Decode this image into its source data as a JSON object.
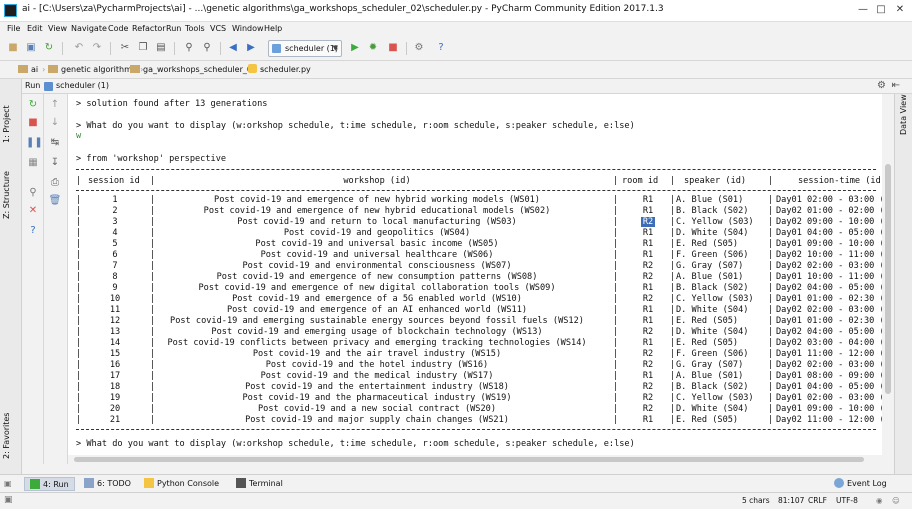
{
  "window": {
    "title": "ai - [C:\\Users\\za\\PycharmProjects\\ai] - ...\\genetic algorithms\\ga_workshops_scheduler_02\\scheduler.py - PyCharm Community Edition 2017.1.3"
  },
  "menu": [
    "File",
    "Edit",
    "View",
    "Navigate",
    "Code",
    "Refactor",
    "Run",
    "Tools",
    "VCS",
    "Window",
    "Help"
  ],
  "toolbar": {
    "run_config": "scheduler (1)"
  },
  "breadcrumbs": [
    "ai",
    "genetic algorithms",
    "ga_workshops_scheduler_02",
    "scheduler.py"
  ],
  "run_panel": {
    "label": "Run",
    "config_name": "scheduler (1)"
  },
  "side_tabs": {
    "project": "1: Project",
    "structure": "Z: Structure",
    "favorites": "2: Favorites",
    "data_view": "Data View"
  },
  "console": {
    "line1": "> solution found after 13 generations",
    "line2": "> What do you want to display (w:orkshop schedule, t:ime schedule, r:oom schedule, s:peaker schedule, e:lse)",
    "input": "w",
    "line3": "> from 'workshop' perspective",
    "header": {
      "session_id": "session id",
      "workshop": "workshop (id)",
      "room_id": "room id",
      "speaker": "speaker (id)",
      "session_time": "session-time (id)"
    },
    "rows": [
      {
        "id": "1",
        "workshop": "Post covid-19 and emergence of new hybrid working models (WS01)",
        "room": "R1",
        "speaker": "A. Blue (S01)",
        "time": "Day01 02:00 - 03:00 (d"
      },
      {
        "id": "2",
        "workshop": "Post covid-19 and emergence of new hybrid educational models (WS02)",
        "room": "R1",
        "speaker": "B. Black (S02)",
        "time": "Day02 01:00 - 02:00 (d"
      },
      {
        "id": "3",
        "workshop": "Post covid-19 and return to local manufacturing (WS03)",
        "room": "R2",
        "speaker": "C. Yellow (S03)",
        "time": "Day02 09:00 - 10:00 (d"
      },
      {
        "id": "4",
        "workshop": "Post covid-19 and geopolitics (WS04)",
        "room": "R1",
        "speaker": "D. White (S04)",
        "time": "Day01 04:00 - 05:00 (d"
      },
      {
        "id": "5",
        "workshop": "Post covid-19 and universal basic income (WS05)",
        "room": "R1",
        "speaker": "E. Red (S05)",
        "time": "Day01 09:00 - 10:00 (d"
      },
      {
        "id": "6",
        "workshop": "Post covid-19 and universal healthcare (WS06)",
        "room": "R1",
        "speaker": "F. Green (S06)",
        "time": "Day02 10:00 - 11:00 (d"
      },
      {
        "id": "7",
        "workshop": "Post covid-19 and environmental consciousness (WS07)",
        "room": "R2",
        "speaker": "G. Gray (S07)",
        "time": "Day02 02:00 - 03:00 (d"
      },
      {
        "id": "8",
        "workshop": "Post covid-19 and emergence of new consumption patterns (WS08)",
        "room": "R2",
        "speaker": "A. Blue (S01)",
        "time": "Day01 10:00 - 11:00 (d"
      },
      {
        "id": "9",
        "workshop": "Post covid-19 and emergence of new digital collaboration tools (WS09)",
        "room": "R1",
        "speaker": "B. Black (S02)",
        "time": "Day02 04:00 - 05:00 (d"
      },
      {
        "id": "10",
        "workshop": "Post covid-19 and emergence of a 5G enabled world (WS10)",
        "room": "R2",
        "speaker": "C. Yellow (S03)",
        "time": "Day01 01:00 - 02:30 (d"
      },
      {
        "id": "11",
        "workshop": "Post covid-19 and emergence of an AI enhanced world (WS11)",
        "room": "R1",
        "speaker": "D. White (S04)",
        "time": "Day02 02:00 - 03:00 (d"
      },
      {
        "id": "12",
        "workshop": "Post covid-19 and emerging sustainable energy sources beyond fossil fuels (WS12)",
        "room": "R1",
        "speaker": "E. Red (S05)",
        "time": "Day01 01:00 - 02:30 (d"
      },
      {
        "id": "13",
        "workshop": "Post covid-19 and emerging usage of blockchain technology (WS13)",
        "room": "R2",
        "speaker": "D. White (S04)",
        "time": "Day02 04:00 - 05:00 (d"
      },
      {
        "id": "14",
        "workshop": "Post covid-19 conflicts between privacy and emerging tracking technologies (WS14)",
        "room": "R1",
        "speaker": "E. Red (S05)",
        "time": "Day02 03:00 - 04:00 (d"
      },
      {
        "id": "15",
        "workshop": "Post covid-19 and the air travel industry (WS15)",
        "room": "R2",
        "speaker": "F. Green (S06)",
        "time": "Day01 11:00 - 12:00 (d"
      },
      {
        "id": "16",
        "workshop": "Post covid-19 and the hotel industry (WS16)",
        "room": "R2",
        "speaker": "G. Gray (S07)",
        "time": "Day02 02:00 - 03:00 (d"
      },
      {
        "id": "17",
        "workshop": "Post covid-19 and the medical industry (WS17)",
        "room": "R1",
        "speaker": "A. Blue (S01)",
        "time": "Day01 08:00 - 09:00 (d"
      },
      {
        "id": "18",
        "workshop": "Post covid-19 and the entertainment industry (WS18)",
        "room": "R2",
        "speaker": "B. Black (S02)",
        "time": "Day01 04:00 - 05:00 (d"
      },
      {
        "id": "19",
        "workshop": "Post covid-19 and the pharmaceutical industry (WS19)",
        "room": "R2",
        "speaker": "C. Yellow (S03)",
        "time": "Day01 02:00 - 03:00 (d"
      },
      {
        "id": "20",
        "workshop": "Post covid-19 and a new social contract (WS20)",
        "room": "R2",
        "speaker": "D. White (S04)",
        "time": "Day01 09:00 - 10:00 (d"
      },
      {
        "id": "21",
        "workshop": "Post covid-19 and major supply chain changes (WS21)",
        "room": "R1",
        "speaker": "E. Red (S05)",
        "time": "Day02 11:00 - 12:00 (d"
      }
    ],
    "prompt_again": "> What do you want to display (w:orkshop schedule, t:ime schedule, r:oom schedule, s:peaker schedule, e:lse)"
  },
  "bottom_tabs": [
    "4: Run",
    "6: TODO",
    "Python Console",
    "Terminal"
  ],
  "event_log": "Event Log",
  "status": {
    "chars": "5 chars",
    "position": "81:107",
    "line_sep": "CRLF",
    "encoding": "UTF-8"
  },
  "colors": {
    "run_green": "#3cab3c",
    "debug_green": "#4a9c3a",
    "stop_red": "#d9534f",
    "selection_blue": "#3d6db6"
  }
}
